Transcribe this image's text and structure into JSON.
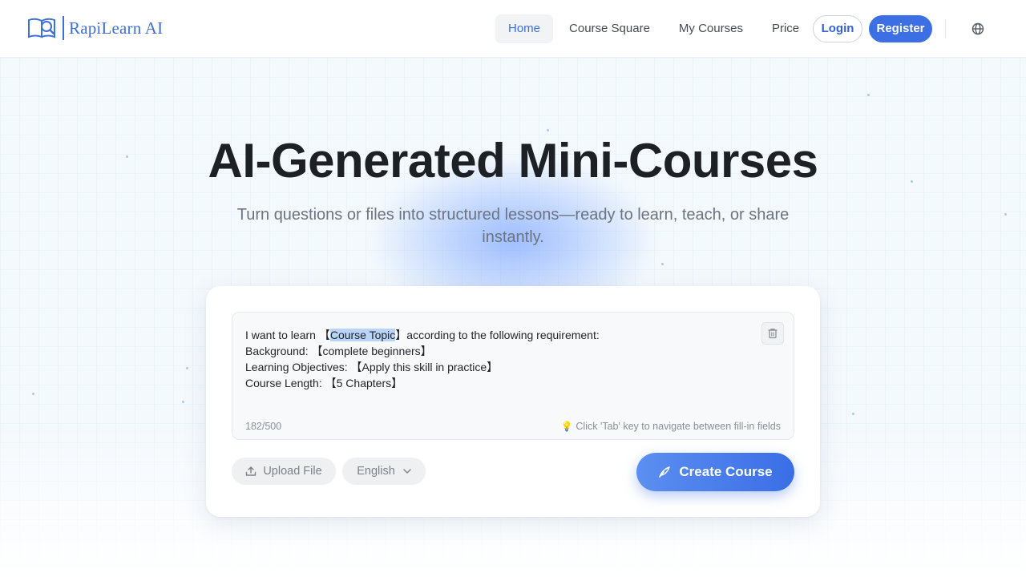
{
  "brand": {
    "name": "RapiLearn AI"
  },
  "nav": {
    "items": [
      {
        "label": "Home",
        "active": true
      },
      {
        "label": "Course Square",
        "active": false
      },
      {
        "label": "My Courses",
        "active": false
      },
      {
        "label": "Price",
        "active": false
      }
    ],
    "login_label": "Login",
    "register_label": "Register",
    "language_icon": "globe-icon"
  },
  "hero": {
    "title": "AI-Generated Mini-Courses",
    "subtitle": "Turn questions or files into structured lessons—ready to learn, teach, or share instantly."
  },
  "composer": {
    "line1_prefix": "I want to learn 【",
    "line1_highlight": "Course Topic",
    "line1_suffix": "】according to the following requirement:",
    "line2": "Background: 【complete beginners】",
    "line3": "Learning Objectives: 【Apply this skill in practice】",
    "line4": "Course Length: 【5 Chapters】",
    "char_count": "182/500",
    "hint": "Click 'Tab' key to navigate between fill-in fields",
    "clear_icon": "trash-icon"
  },
  "actions": {
    "upload_label": "Upload File",
    "language_selected": "English",
    "create_label": "Create Course"
  },
  "colors": {
    "primary": "#3b6fe3",
    "brand_text": "#3f6fd3",
    "title_text": "#1d2126",
    "muted_text": "#6b7480"
  }
}
